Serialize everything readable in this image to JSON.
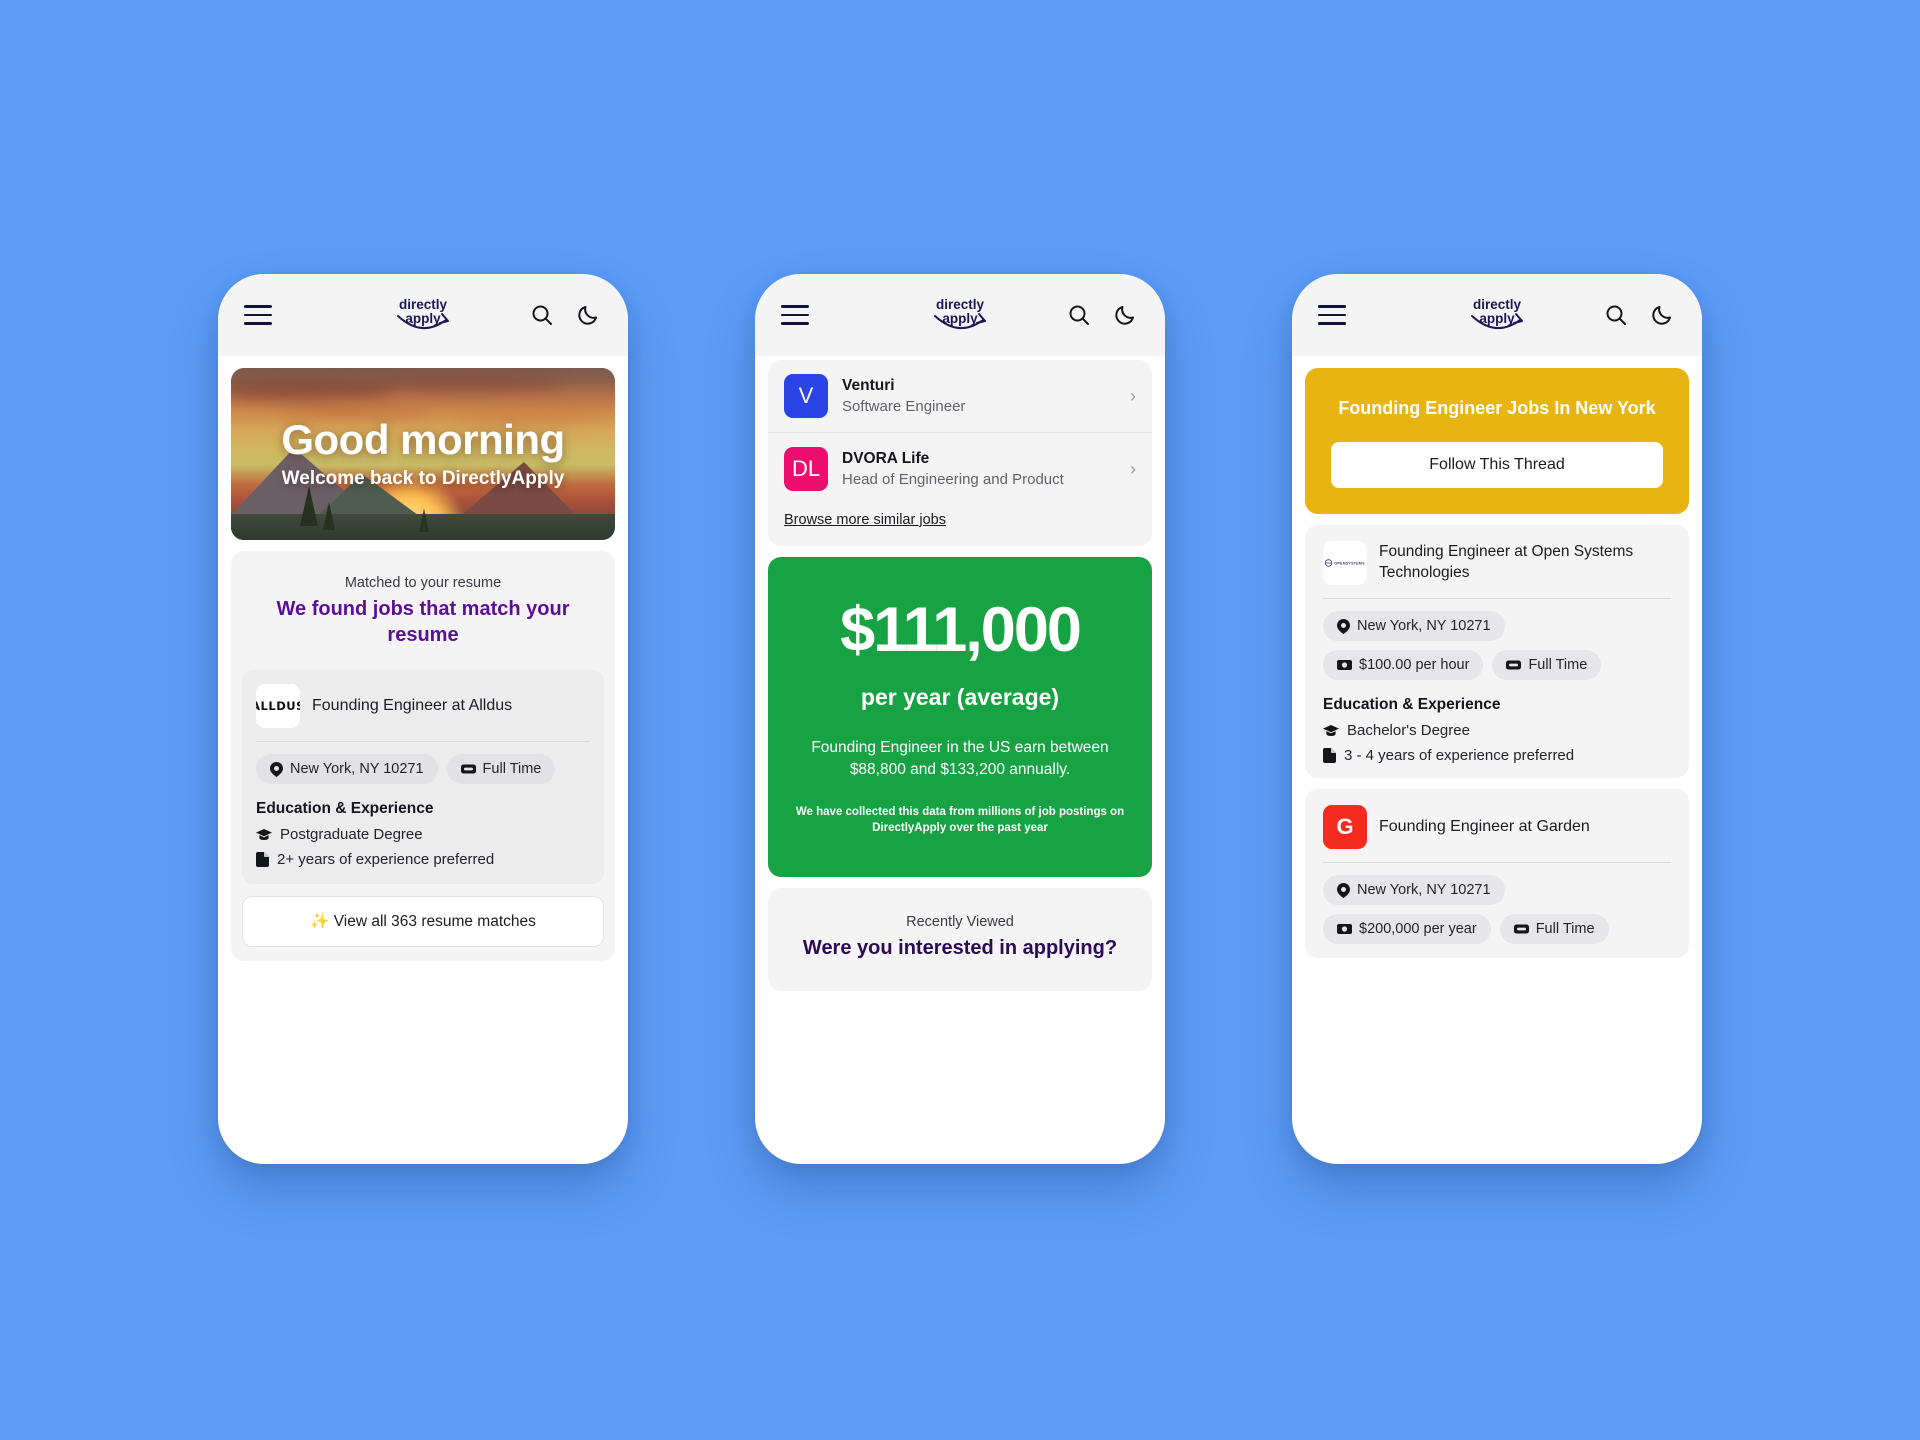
{
  "brand": {
    "line1": "directly",
    "line2": "apply"
  },
  "icons": {
    "menu": "hamburger-icon",
    "search": "search-icon",
    "theme": "moon-icon"
  },
  "phone1": {
    "hero": {
      "title": "Good morning",
      "subtitle": "Welcome back to DirectlyApply"
    },
    "match": {
      "eyebrow": "Matched to your resume",
      "title": "We found jobs that match your resume"
    },
    "job": {
      "logo_text": "ALLDUS",
      "title": "Founding Engineer at Alldus",
      "location": "New York, NY 10271",
      "type": "Full Time",
      "education_heading": "Education & Experience",
      "education": "Postgraduate Degree",
      "experience": "2+ years of experience preferred"
    },
    "view_all": "✨ View all 363 resume matches"
  },
  "phone2": {
    "similar_jobs": [
      {
        "initials": "V",
        "company": "Venturi",
        "role": "Software Engineer",
        "color": "blue"
      },
      {
        "initials": "DL",
        "company": "DVORA Life",
        "role": "Head of Engineering and Product",
        "color": "pink"
      }
    ],
    "browse_more": "Browse more similar jobs",
    "salary": {
      "amount": "$111,000",
      "period": "per year (average)",
      "description": "Founding Engineer in the US earn between $88,800 and $133,200 annually.",
      "note": "We have collected this data from millions of job postings on DirectlyApply over the past year"
    },
    "recent": {
      "eyebrow": "Recently Viewed",
      "title": "Were you interested in applying?"
    }
  },
  "phone3": {
    "thread": {
      "title": "Founding Engineer Jobs In New York",
      "button": "Follow This Thread"
    },
    "jobs": [
      {
        "logo_type": "opensystems",
        "logo_text": "OPENSYSTEMS",
        "title": "Founding Engineer at Open Systems Technologies",
        "location": "New York, NY 10271",
        "pay": "$100.00 per hour",
        "type": "Full Time",
        "education_heading": "Education & Experience",
        "education": "Bachelor's Degree",
        "experience": "3 - 4 years of experience preferred"
      },
      {
        "logo_type": "letter",
        "logo_text": "G",
        "title": "Founding Engineer at Garden",
        "location": "New York, NY 10271",
        "pay": "$200,000 per year",
        "type": "Full Time"
      }
    ]
  },
  "colors": {
    "background": "#5b9cf8",
    "brand_purple": "#5b0f96",
    "salary_green": "#17a344",
    "thread_yellow": "#e8b411",
    "venturi_blue": "#2a44e8",
    "dvora_pink": "#ec0e6e",
    "garden_red": "#f62b20"
  }
}
